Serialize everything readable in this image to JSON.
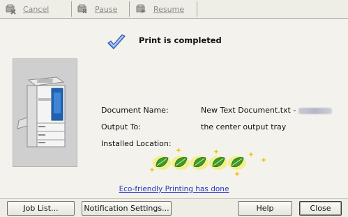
{
  "toolbar": {
    "cancel_label": "Cancel",
    "pause_label": "Pause",
    "resume_label": "Resume"
  },
  "status": {
    "title": "Print is completed",
    "icon": "checkmark-icon"
  },
  "details": {
    "document_name_label": "Document Name:",
    "document_name_value": "New Text Document.txt -",
    "output_to_label": "Output To:",
    "output_to_value": "the center output tray",
    "installed_location_label": "Installed Location:"
  },
  "eco": {
    "leaf_count": 5,
    "link_text": "Eco-friendly Printing has done"
  },
  "buttons": {
    "job_list": "Job List...",
    "notification_settings": "Notification Settings...",
    "help": "Help",
    "close": "Close"
  },
  "colors": {
    "link": "#2b36c8",
    "leaf_green": "#3f9a2a",
    "leaf_glow": "#f2ee7a",
    "check_blue": "#3d6fc4"
  }
}
